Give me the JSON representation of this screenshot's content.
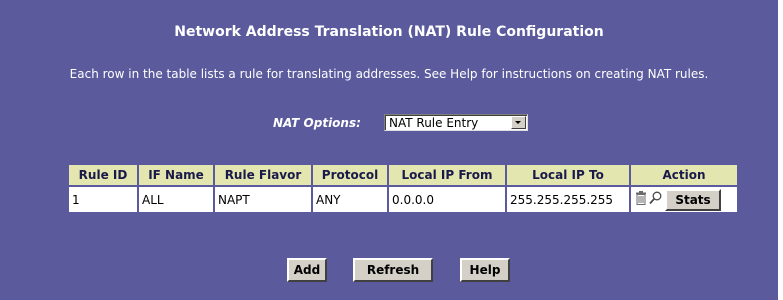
{
  "page": {
    "title": "Network Address Translation (NAT) Rule Configuration",
    "description": "Each row in the table lists a rule for translating addresses. See Help for instructions on creating NAT rules."
  },
  "nat_options": {
    "label": "NAT Options:",
    "selected": "NAT Rule Entry"
  },
  "table": {
    "headers": [
      "Rule ID",
      "IF Name",
      "Rule Flavor",
      "Protocol",
      "Local IP From",
      "Local IP To",
      "Action"
    ],
    "rows": [
      {
        "rule_id": "1",
        "if_name": "ALL",
        "rule_flavor": "NAPT",
        "protocol": "ANY",
        "local_ip_from": "0.0.0.0",
        "local_ip_to": "255.255.255.255",
        "stats_label": "Stats",
        "icons": [
          "trash-icon",
          "magnifier-icon"
        ]
      }
    ]
  },
  "buttons": {
    "add": "Add",
    "refresh": "Refresh",
    "help": "Help"
  },
  "colors": {
    "panel_bg": "#5a5a9c",
    "header_bg": "#e3e6ae",
    "button_face": "#d4d0c8"
  }
}
